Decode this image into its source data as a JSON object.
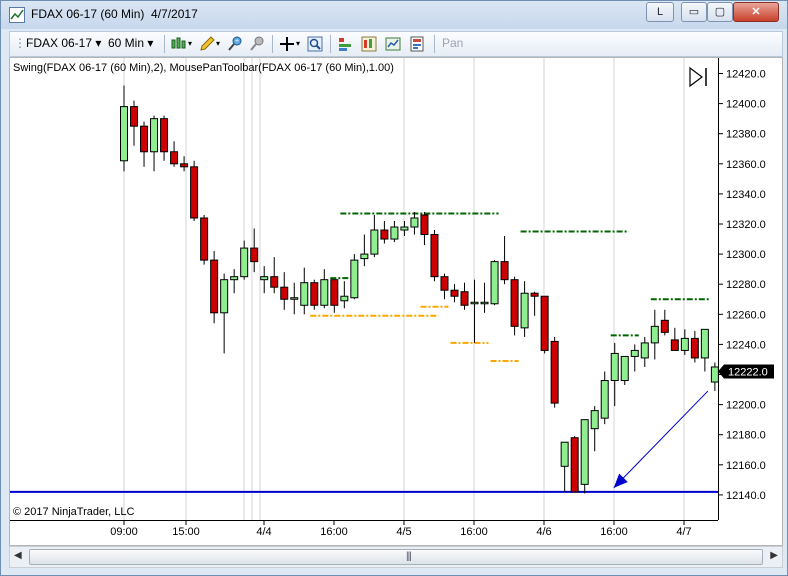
{
  "window": {
    "title": "FDAX 06-17 (60 Min)  4/7/2017",
    "controls": {
      "l_label": "L",
      "min_glyph": "▭",
      "max_glyph": "▢",
      "close_glyph": "✕"
    }
  },
  "toolbar": {
    "instrument": "FDAX 06-17",
    "interval": "60 Min",
    "pan_label": "Pan",
    "icons": [
      "candlestick-style-icon",
      "pencil-draw-icon",
      "pin-add-icon",
      "pin-remove-icon",
      "crosshair-icon",
      "zoom-icon",
      "bar-spacing-icon",
      "data-box-icon",
      "chart-properties-icon",
      "templates-icon"
    ]
  },
  "chart": {
    "indicator_label": "Swing(FDAX 06-17 (60 Min),2), MousePanToolbar(FDAX 06-17 (60 Min),1.00)",
    "copyright": "© 2017 NinjaTrader, LLC",
    "colors": {
      "up": "#90EE90",
      "down": "#CC0000",
      "swing_high": "#006400",
      "swing_low": "#FFA500",
      "annotation": "#0000CD",
      "price_marker": "#000000"
    }
  },
  "chart_data": {
    "type": "candlestick",
    "instrument": "FDAX 06-17",
    "interval": "60 Min",
    "y_ticks": [
      "12420.0",
      "12400.0",
      "12380.0",
      "12360.0",
      "12340.0",
      "12320.0",
      "12300.0",
      "12280.0",
      "12260.0",
      "12240.0",
      "12220.0",
      "12200.0",
      "12180.0",
      "12160.0",
      "12140.0"
    ],
    "x_ticks": [
      "09:00",
      "15:00",
      "4/4",
      "16:00",
      "4/5",
      "16:00",
      "4/6",
      "16:00",
      "4/7"
    ],
    "ylim": [
      12132,
      12426
    ],
    "last_price": "12222.0",
    "horizontal_line": 12142,
    "candles": [
      {
        "o": 12362,
        "h": 12412,
        "l": 12355,
        "c": 12398
      },
      {
        "o": 12398,
        "h": 12402,
        "l": 12372,
        "c": 12385
      },
      {
        "o": 12385,
        "h": 12388,
        "l": 12358,
        "c": 12368
      },
      {
        "o": 12368,
        "h": 12392,
        "l": 12355,
        "c": 12390
      },
      {
        "o": 12390,
        "h": 12392,
        "l": 12362,
        "c": 12368
      },
      {
        "o": 12368,
        "h": 12375,
        "l": 12358,
        "c": 12360
      },
      {
        "o": 12360,
        "h": 12365,
        "l": 12355,
        "c": 12358
      },
      {
        "o": 12358,
        "h": 12362,
        "l": 12322,
        "c": 12324
      },
      {
        "o": 12324,
        "h": 12326,
        "l": 12293,
        "c": 12296
      },
      {
        "o": 12296,
        "h": 12302,
        "l": 12254,
        "c": 12261
      },
      {
        "o": 12261,
        "h": 12287,
        "l": 12234,
        "c": 12283
      },
      {
        "o": 12283,
        "h": 12290,
        "l": 12274,
        "c": 12285
      },
      {
        "o": 12285,
        "h": 12309,
        "l": 12283,
        "c": 12304
      },
      {
        "o": 12304,
        "h": 12317,
        "l": 12288,
        "c": 12295
      },
      {
        "o": 12283,
        "h": 12292,
        "l": 12274,
        "c": 12285
      },
      {
        "o": 12285,
        "h": 12298,
        "l": 12274,
        "c": 12278
      },
      {
        "o": 12278,
        "h": 12288,
        "l": 12263,
        "c": 12270
      },
      {
        "o": 12270,
        "h": 12281,
        "l": 12260,
        "c": 12271
      },
      {
        "o": 12266,
        "h": 12291,
        "l": 12260,
        "c": 12281
      },
      {
        "o": 12281,
        "h": 12283,
        "l": 12263,
        "c": 12266
      },
      {
        "o": 12266,
        "h": 12290,
        "l": 12264,
        "c": 12283
      },
      {
        "o": 12283,
        "h": 12282,
        "l": 12261,
        "c": 12266
      },
      {
        "o": 12269,
        "h": 12282,
        "l": 12264,
        "c": 12272
      },
      {
        "o": 12271,
        "h": 12300,
        "l": 12270,
        "c": 12296
      },
      {
        "o": 12297,
        "h": 12313,
        "l": 12292,
        "c": 12300
      },
      {
        "o": 12300,
        "h": 12326,
        "l": 12298,
        "c": 12316
      },
      {
        "o": 12316,
        "h": 12322,
        "l": 12307,
        "c": 12310
      },
      {
        "o": 12310,
        "h": 12322,
        "l": 12308,
        "c": 12318
      },
      {
        "o": 12316,
        "h": 12322,
        "l": 12312,
        "c": 12318
      },
      {
        "o": 12318,
        "h": 12328,
        "l": 12313,
        "c": 12324
      },
      {
        "o": 12326,
        "h": 12328,
        "l": 12306,
        "c": 12313
      },
      {
        "o": 12313,
        "h": 12316,
        "l": 12282,
        "c": 12285
      },
      {
        "o": 12285,
        "h": 12287,
        "l": 12270,
        "c": 12276
      },
      {
        "o": 12276,
        "h": 12280,
        "l": 12268,
        "c": 12272
      },
      {
        "o": 12275,
        "h": 12281,
        "l": 12263,
        "c": 12266
      },
      {
        "o": 12267,
        "h": 12283,
        "l": 12241,
        "c": 12268
      },
      {
        "o": 12267,
        "h": 12281,
        "l": 12261,
        "c": 12268
      },
      {
        "o": 12267,
        "h": 12296,
        "l": 12266,
        "c": 12295
      },
      {
        "o": 12295,
        "h": 12312,
        "l": 12280,
        "c": 12283
      },
      {
        "o": 12283,
        "h": 12285,
        "l": 12246,
        "c": 12252
      },
      {
        "o": 12251,
        "h": 12282,
        "l": 12245,
        "c": 12274
      },
      {
        "o": 12274,
        "h": 12275,
        "l": 12259,
        "c": 12272
      },
      {
        "o": 12272,
        "h": 12270,
        "l": 12234,
        "c": 12236
      },
      {
        "o": 12242,
        "h": 12245,
        "l": 12198,
        "c": 12201
      },
      {
        "o": 12159,
        "h": 12175,
        "l": 12142,
        "c": 12175
      },
      {
        "o": 12178,
        "h": 12179,
        "l": 12142,
        "c": 12142
      },
      {
        "o": 12147,
        "h": 12184,
        "l": 12141,
        "c": 12190
      },
      {
        "o": 12184,
        "h": 12199,
        "l": 12169,
        "c": 12196
      },
      {
        "o": 12191,
        "h": 12222,
        "l": 12187,
        "c": 12216
      },
      {
        "o": 12216,
        "h": 12241,
        "l": 12199,
        "c": 12234
      },
      {
        "o": 12216,
        "h": 12230,
        "l": 12213,
        "c": 12232
      },
      {
        "o": 12232,
        "h": 12240,
        "l": 12222,
        "c": 12236
      },
      {
        "o": 12231,
        "h": 12245,
        "l": 12225,
        "c": 12241
      },
      {
        "o": 12241,
        "h": 12263,
        "l": 12230,
        "c": 12252
      },
      {
        "o": 12256,
        "h": 12263,
        "l": 12246,
        "c": 12248
      },
      {
        "o": 12243,
        "h": 12251,
        "l": 12236,
        "c": 12236
      },
      {
        "o": 12236,
        "h": 12250,
        "l": 12233,
        "c": 12244
      },
      {
        "o": 12244,
        "h": 12249,
        "l": 12228,
        "c": 12231
      },
      {
        "o": 12231,
        "h": 12250,
        "l": 12222,
        "c": 12250
      },
      {
        "o": 12215,
        "h": 12228,
        "l": 12209,
        "c": 12225
      }
    ],
    "swing_highs": [
      {
        "from": 22,
        "to": 37,
        "y": 12327
      },
      {
        "from": 40,
        "to": 50,
        "y": 12315
      },
      {
        "from": 49,
        "to": 51,
        "y": 12246
      },
      {
        "from": 53,
        "to": 58,
        "y": 12270
      },
      {
        "from": 21,
        "to": 22,
        "y": 12284
      }
    ],
    "swing_lows": [
      {
        "from": 19,
        "to": 31,
        "y": 12259
      },
      {
        "from": 30,
        "to": 32,
        "y": 12265
      },
      {
        "from": 33,
        "to": 36,
        "y": 12241
      },
      {
        "from": 37,
        "to": 39,
        "y": 12229
      }
    ],
    "arrow": {
      "from": {
        "i": 58,
        "y": 12209
      },
      "to": {
        "i": 48,
        "y": 12142
      }
    }
  }
}
